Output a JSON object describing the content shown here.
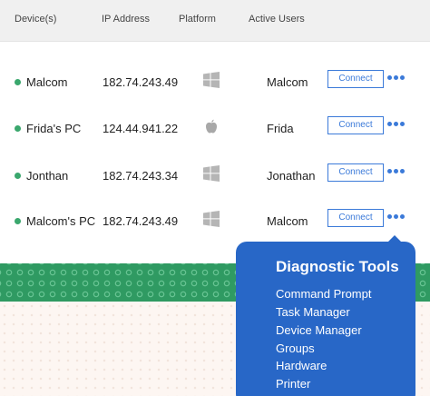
{
  "table": {
    "headers": {
      "device": "Device(s)",
      "ip": "IP Address",
      "platform": "Platform",
      "users": "Active Users"
    },
    "rows": [
      {
        "device": "Malcom",
        "ip": "182.74.243.49",
        "platform_icon": "windows-icon",
        "user": "Malcom",
        "status": "online",
        "connect": "Connect"
      },
      {
        "device": "Frida's PC",
        "ip": "124.44.941.22",
        "platform_icon": "apple-icon",
        "user": "Frida",
        "status": "online",
        "connect": "Connect"
      },
      {
        "device": "Jonthan",
        "ip": "182.74.243.34",
        "platform_icon": "windows-icon",
        "user": "Jonathan",
        "status": "online",
        "connect": "Connect"
      },
      {
        "device": "Malcom's PC",
        "ip": "182.74.243.49",
        "platform_icon": "windows-icon",
        "user": "Malcom",
        "status": "online",
        "connect": "Connect"
      }
    ]
  },
  "diagnostic_menu": {
    "title": "Diagnostic Tools",
    "items": [
      "Command Prompt",
      "Task Manager",
      "Device Manager",
      "Groups",
      "Hardware",
      "Printer"
    ]
  },
  "colors": {
    "accent": "#3b7ad9",
    "status_online": "#3aa76d",
    "popup_bg": "#2867c7",
    "header_bg": "#f0f0f0",
    "band_green": "#2f9a62"
  }
}
